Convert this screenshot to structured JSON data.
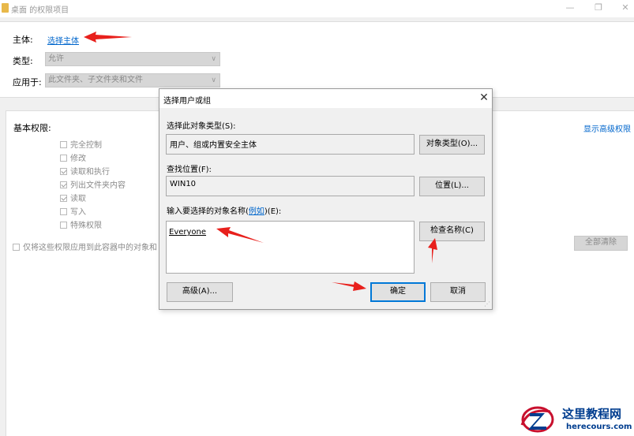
{
  "window": {
    "title": "桌面 的权限项目",
    "minimize_glyph": "—",
    "restore_glyph": "❐",
    "close_glyph": "✕"
  },
  "principal": {
    "label": "主体:",
    "link": "选择主体"
  },
  "type": {
    "label": "类型:",
    "value": "允许"
  },
  "applies_to": {
    "label": "应用于:",
    "value": "此文件夹、子文件夹和文件"
  },
  "basic_permissions": {
    "label": "基本权限:",
    "show_advanced": "显示高级权限",
    "items": [
      {
        "label": "完全控制",
        "checked": false
      },
      {
        "label": "修改",
        "checked": false
      },
      {
        "label": "读取和执行",
        "checked": true
      },
      {
        "label": "列出文件夹内容",
        "checked": true
      },
      {
        "label": "读取",
        "checked": true
      },
      {
        "label": "写入",
        "checked": false
      },
      {
        "label": "特殊权限",
        "checked": false
      }
    ],
    "apply_only": "仅将这些权限应用到此容器中的对象和",
    "clear_all": "全部清除"
  },
  "dialog": {
    "title": "选择用户或组",
    "close_glyph": "✕",
    "object_type_label": "选择此对象类型(S):",
    "object_type_value": "用户、组或内置安全主体",
    "object_type_button": "对象类型(O)...",
    "location_label": "查找位置(F):",
    "location_value": "WIN10",
    "location_button": "位置(L)...",
    "names_label_prefix": "输入要选择的对象名称(",
    "names_label_link": "例如",
    "names_label_suffix": ")(E):",
    "names_value": "Everyone",
    "check_names_button": "检查名称(C)",
    "advanced_button": "高级(A)...",
    "ok_button": "确定",
    "cancel_button": "取消"
  },
  "watermark": {
    "title": "这里教程网",
    "url": "herecours.com"
  },
  "colors": {
    "link": "#0066cc",
    "arrow": "#e8201c",
    "default_border": "#0078d7",
    "watermark": "#003d8f"
  }
}
